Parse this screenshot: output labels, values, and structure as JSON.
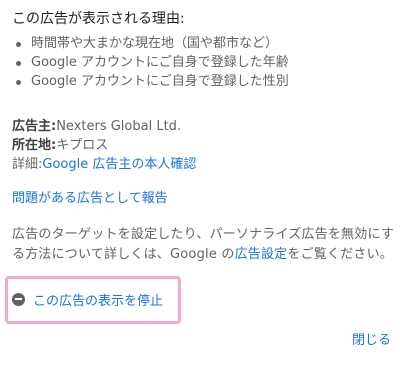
{
  "why_section": {
    "title": "この広告が表示される理由:",
    "reasons": [
      "時間帯や大まかな現在地（国や都市など）",
      "Google アカウントにご自身で登録した年齢",
      "Google アカウントにご自身で登録した性別"
    ]
  },
  "advertiser": {
    "advertiser_label": "広告主:",
    "advertiser_value": "Nexters Global Ltd.",
    "location_label": "所在地:",
    "location_value": "キプロス",
    "details_label": "詳細:",
    "details_link": "Google 広告主の本人確認"
  },
  "report_link": "問題がある広告として報告",
  "targeting": {
    "text_before": "広告のターゲットを設定したり、パーソナライズ広告を無効にする方法について詳しくは、Google の",
    "settings_link": "広告設定",
    "text_after": "をご覧ください。"
  },
  "stop_ad": {
    "label": "この広告の表示を停止",
    "icon": "minus-circle-icon",
    "highlight_color": "#f3a8cd"
  },
  "close_label": "閉じる",
  "colors": {
    "link": "#1a73e8",
    "text": "#5f6368"
  }
}
